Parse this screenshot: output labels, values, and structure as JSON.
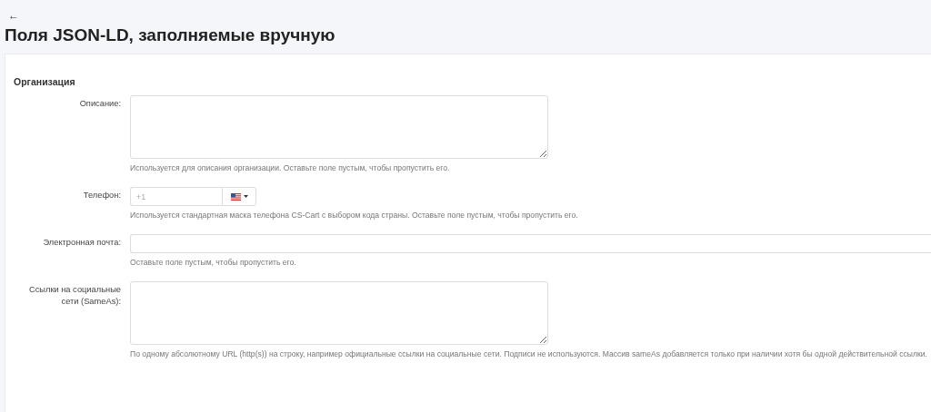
{
  "back": {
    "glyph": "←"
  },
  "title": "Поля JSON-LD, заполняемые вручную",
  "section": {
    "title": "Организация",
    "fields": [
      {
        "kind": "textarea",
        "label": "Описание:",
        "hint": "Используется для описания организации. Оставьте поле пустым, чтобы пропустить его."
      },
      {
        "kind": "phone",
        "label": "Телефон:",
        "placeholder": "+1",
        "hint": "Используется стандартная маска телефона CS-Cart с выбором кода страны. Оставьте поле пустым, чтобы пропустить его."
      },
      {
        "kind": "text",
        "label": "Электронная почта:",
        "hint": "Оставьте поле пустым, чтобы пропустить его."
      },
      {
        "kind": "textarea",
        "label": "Ссылки на социальные сети (SameAs):",
        "hint": "По одному абсолютному URL (http(s)) на строку, например официальные ссылки на социальные сети. Подписи не используются. Массив sameAs добавляется только при наличии хотя бы одной действительной ссылки."
      }
    ]
  }
}
